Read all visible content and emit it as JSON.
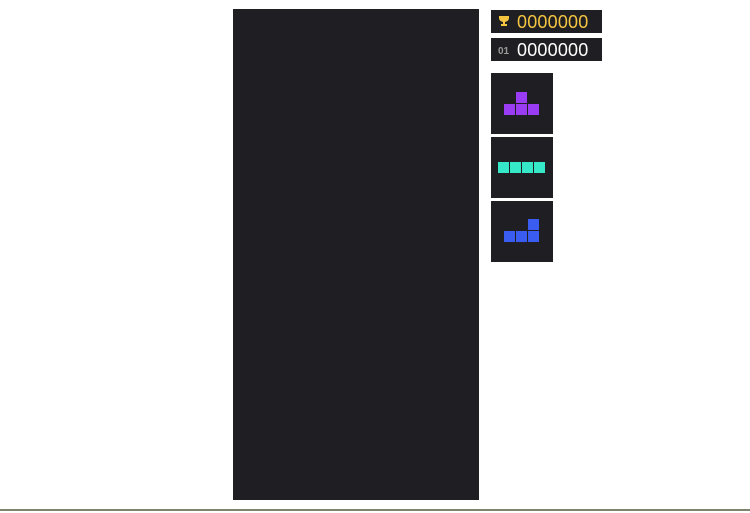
{
  "scores": {
    "best": "0000000",
    "current": "0000000",
    "level_glyph": "01"
  },
  "icons": {
    "best": "trophy-icon"
  },
  "colors": {
    "board": "#1f1f23",
    "best_score": "#f5c542",
    "current_score": "#ffffff",
    "rule": "#7d8570"
  },
  "next_pieces": [
    {
      "shape": "T",
      "color": "#9b3cf5"
    },
    {
      "shape": "I",
      "color": "#34e8c8"
    },
    {
      "shape": "L",
      "color": "#3b5cf0"
    }
  ]
}
